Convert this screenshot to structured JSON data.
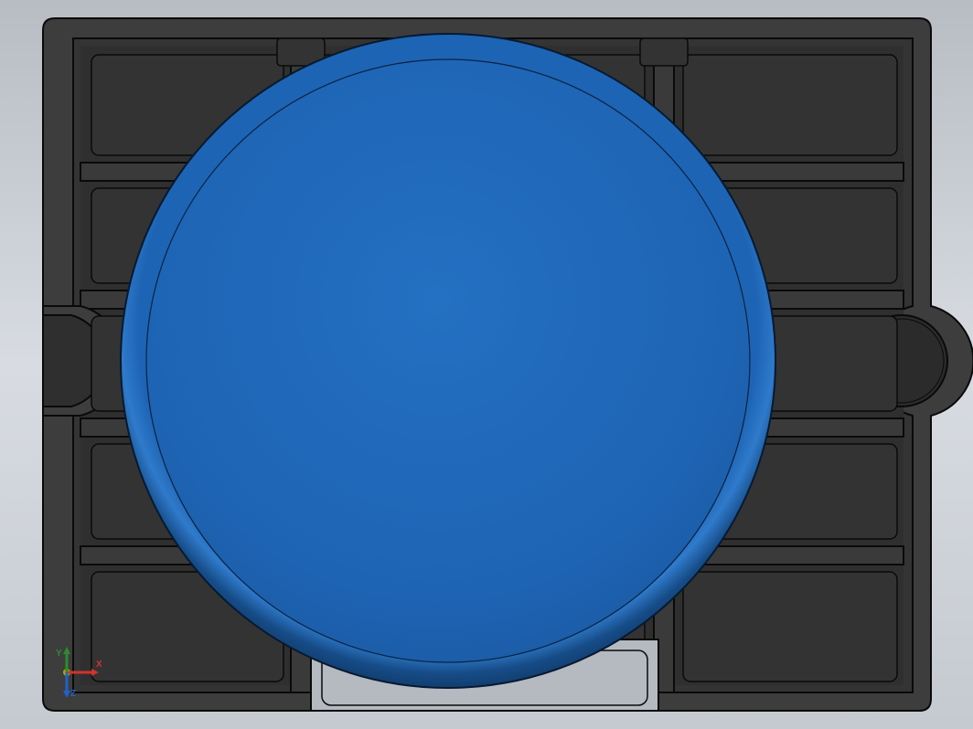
{
  "axis_triad": {
    "labels": {
      "x": "X",
      "y": "Y",
      "z": "Z"
    },
    "colors": {
      "x": "#d0342c",
      "y": "#2e8b2e",
      "z": "#1e62c9"
    }
  },
  "model": {
    "part_base_color": "#3d3d3d",
    "part_cavity_color": "#343434",
    "disc_face_color": "#1e64b4",
    "disc_rim_color": "#164c87",
    "disc_rim_highlight": "#2f78c8",
    "edge_color": "#0a0a0a",
    "slot_fill": "#b5b9c0"
  }
}
